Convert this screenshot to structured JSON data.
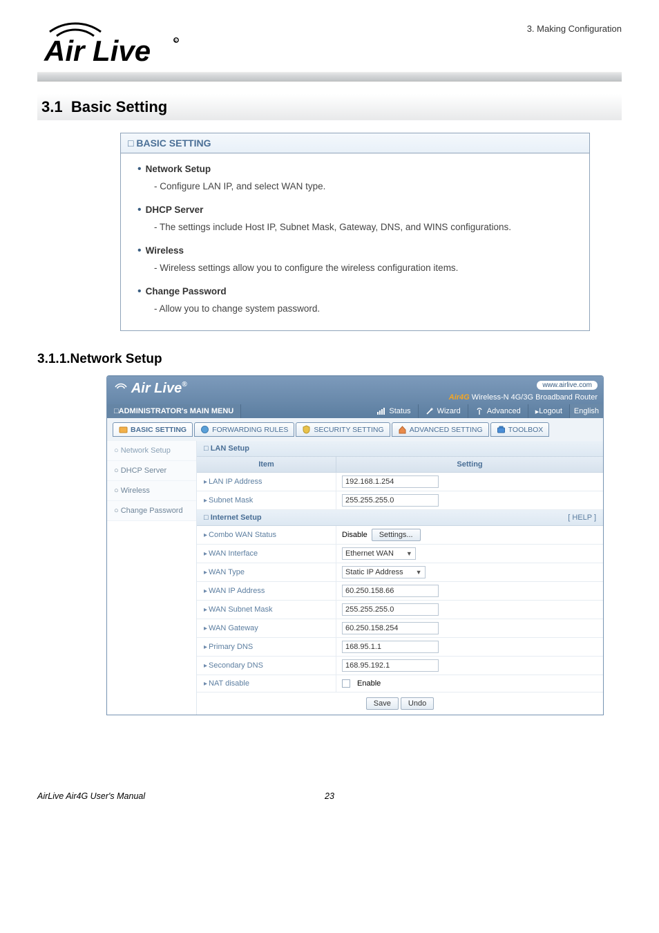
{
  "doc": {
    "context": "3.  Making  Configuration",
    "section_number": "3.1",
    "section_title": "Basic Setting",
    "subsection_number": "3.1.1.",
    "subsection_title": "Network Setup",
    "footer_left": "AirLive Air4G User's Manual",
    "footer_page": "23"
  },
  "panel": {
    "title": "BASIC SETTING",
    "items": [
      {
        "title": "Network Setup",
        "desc": "- Configure LAN IP, and select WAN type."
      },
      {
        "title": "DHCP Server",
        "desc": "- The settings include Host IP, Subnet Mask, Gateway, DNS, and WINS configurations."
      },
      {
        "title": "Wireless",
        "desc": "- Wireless settings allow you to configure the wireless configuration items."
      },
      {
        "title": "Change Password",
        "desc": "- Allow you to change system password."
      }
    ]
  },
  "shot": {
    "logo_text": "Air Live",
    "pill": "www.airlive.com",
    "tag_prefix": "Air4G",
    "tag_rest": " Wireless-N 4G/3G Broadband Router",
    "admin_menu_label": "ADMINISTRATOR's MAIN MENU",
    "topnav": {
      "status": "Status",
      "wizard": "Wizard",
      "advanced": "Advanced",
      "logout": "Logout",
      "lang": "English"
    },
    "tabs": {
      "basic": "BASIC SETTING",
      "forwarding": "FORWARDING RULES",
      "security": "SECURITY SETTING",
      "advanced": "ADVANCED SETTING",
      "toolbox": "TOOLBOX"
    },
    "side": [
      "Network Setup",
      "DHCP Server",
      "Wireless",
      "Change Password"
    ],
    "grp_lan": "LAN Setup",
    "grp_internet": "Internet Setup",
    "help": "[ HELP ]",
    "hdr_item": "Item",
    "hdr_setting": "Setting",
    "rows": {
      "lan_ip_lbl": "LAN IP Address",
      "lan_ip_val": "192.168.1.254",
      "subnet_lbl": "Subnet Mask",
      "subnet_val": "255.255.255.0",
      "combo_lbl": "Combo WAN Status",
      "combo_status": "Disable",
      "combo_btn": "Settings...",
      "wanif_lbl": "WAN Interface",
      "wanif_val": "Ethernet WAN",
      "wantype_lbl": "WAN Type",
      "wantype_val": "Static IP Address",
      "wanip_lbl": "WAN IP Address",
      "wanip_val": "60.250.158.66",
      "wansub_lbl": "WAN Subnet Mask",
      "wansub_val": "255.255.255.0",
      "wangw_lbl": "WAN Gateway",
      "wangw_val": "60.250.158.254",
      "pdns_lbl": "Primary DNS",
      "pdns_val": "168.95.1.1",
      "sdns_lbl": "Secondary DNS",
      "sdns_val": "168.95.192.1",
      "nat_lbl": "NAT disable",
      "nat_cb": "Enable"
    },
    "btn_save": "Save",
    "btn_undo": "Undo"
  }
}
